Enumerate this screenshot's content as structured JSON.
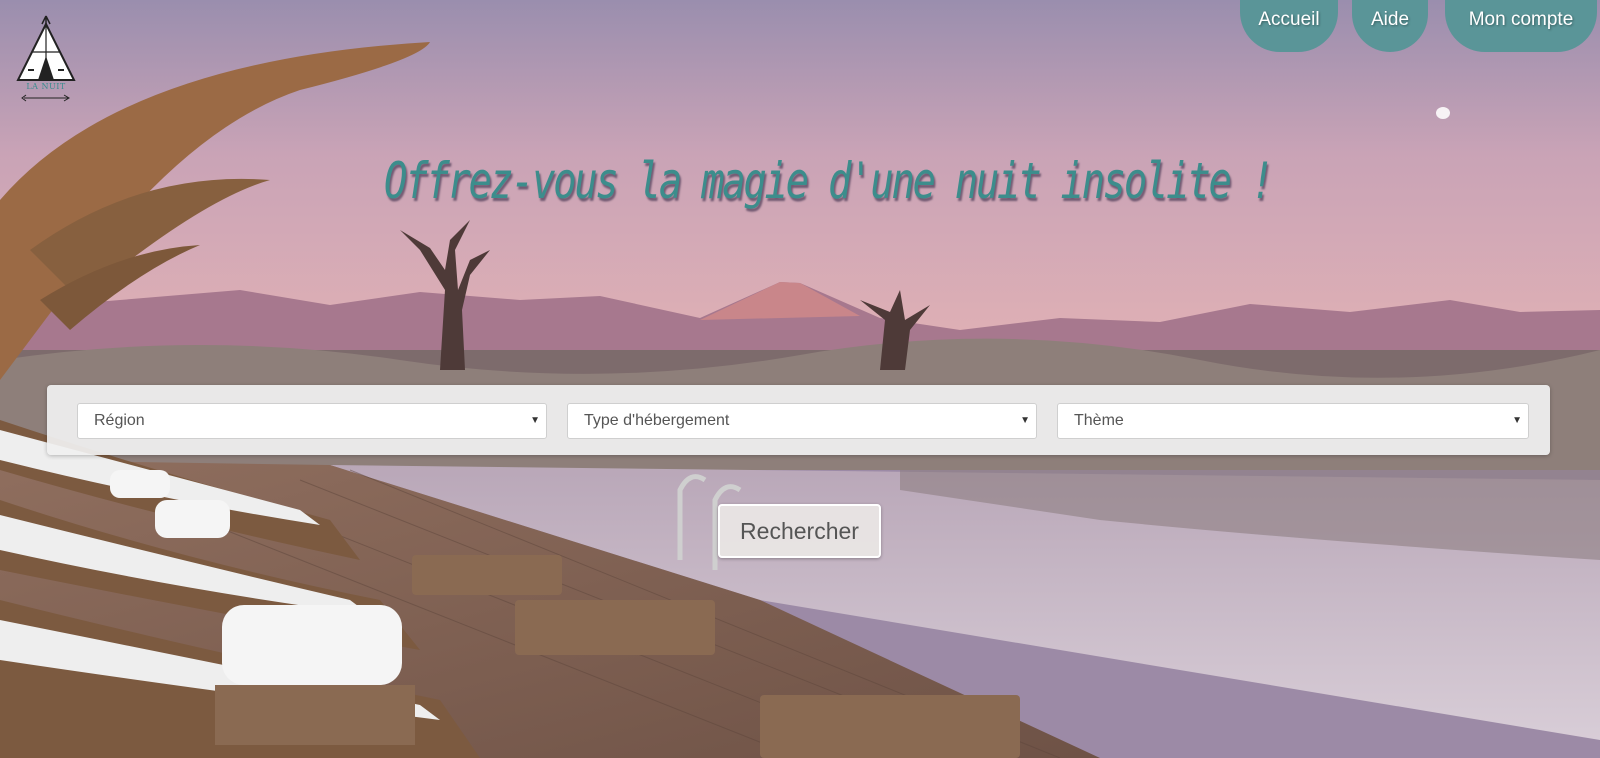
{
  "logo": {
    "icon": "teepee-icon",
    "text": "LA NUIT"
  },
  "nav": {
    "items": [
      {
        "label": "Accueil"
      },
      {
        "label": "Aide"
      },
      {
        "label": "Mon compte"
      }
    ]
  },
  "hero": {
    "title": "Offrez-vous la magie d'une nuit insolite !"
  },
  "search": {
    "region": {
      "selected": "Région"
    },
    "type": {
      "selected": "Type d'hébergement"
    },
    "theme": {
      "selected": "Thème"
    },
    "button_label": "Rechercher"
  },
  "colors": {
    "accent": "#5a9598",
    "title": "#3c8d8c"
  }
}
